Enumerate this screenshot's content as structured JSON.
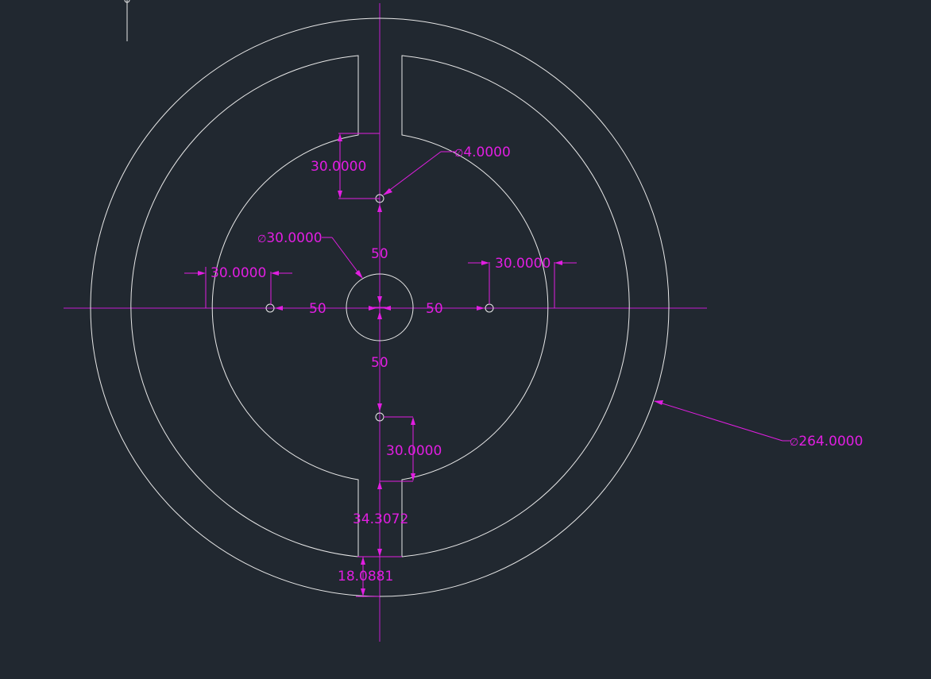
{
  "dimensions": {
    "top_hole_offset": "30.0000",
    "small_hole_diameter": "4.0000",
    "center_hole_diameter": "30.0000",
    "left_hole_offset": "30.0000",
    "right_hole_offset": "30.0000",
    "vertical_spacing_top": "50",
    "vertical_spacing_bottom": "50",
    "horizontal_spacing_left": "50",
    "horizontal_spacing_right": "50",
    "bottom_hole_offset": "30.0000",
    "slot_depth": "34.3072",
    "rim_thickness": "18.0881",
    "outer_diameter": "264.0000"
  },
  "symbols": {
    "diameter": "∅"
  },
  "colors": {
    "background": "#212830",
    "geometry": "#e8e8e8",
    "dimension": "#e11ee1",
    "centerline": "#c21bd0"
  }
}
